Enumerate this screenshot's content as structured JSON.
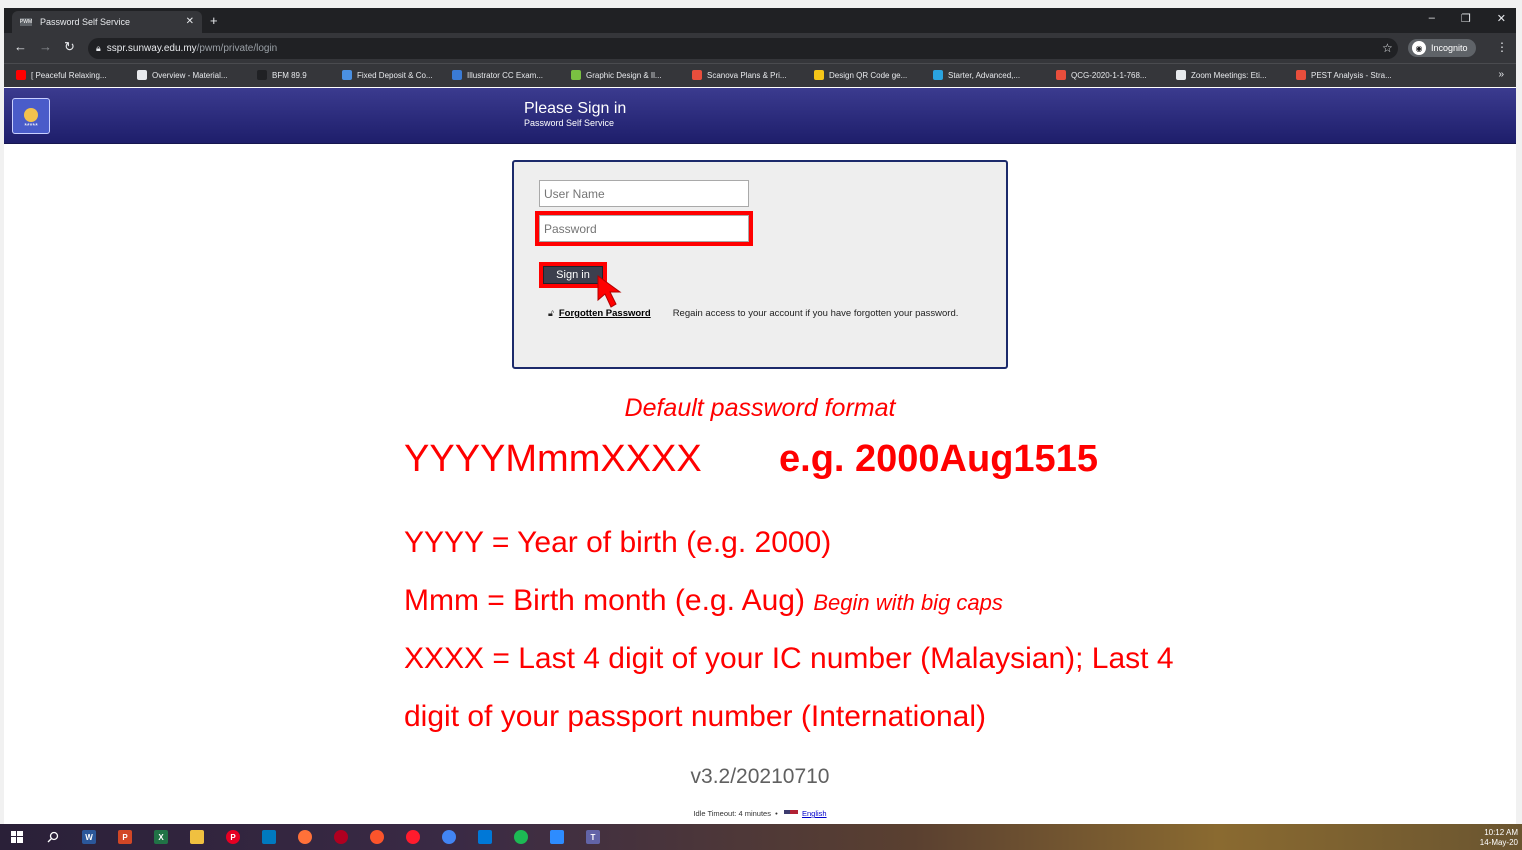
{
  "browser": {
    "tab_title": "Password Self Service",
    "tab_favicon": "PWM",
    "url_host": "sspr.sunway.edu.my",
    "url_path": "/pwm/private/login",
    "incognito_label": "Incognito",
    "bookmarks": [
      {
        "label": "[ Peaceful Relaxing...",
        "color": "#ff0000"
      },
      {
        "label": "Overview - Material...",
        "color": "#e8eaed"
      },
      {
        "label": "BFM 89.9",
        "color": "#202124"
      },
      {
        "label": "Fixed Deposit & Co...",
        "color": "#4a90e2"
      },
      {
        "label": "Illustrator CC Exam...",
        "color": "#3a7bd5"
      },
      {
        "label": "Graphic Design & Il...",
        "color": "#7ac142"
      },
      {
        "label": "Scanova Plans & Pri...",
        "color": "#e94e3c"
      },
      {
        "label": "Design QR Code ge...",
        "color": "#f5c518"
      },
      {
        "label": "Starter, Advanced,...",
        "color": "#2aa3e0"
      },
      {
        "label": "QCG-2020-1-1-768...",
        "color": "#e94e3c"
      },
      {
        "label": "Zoom Meetings: Eti...",
        "color": "#e8eaed"
      },
      {
        "label": "PEST Analysis - Stra...",
        "color": "#e94e3c"
      }
    ]
  },
  "header": {
    "title": "Please Sign in",
    "subtitle": "Password Self Service",
    "logo_stars": "*****"
  },
  "login": {
    "username_placeholder": "User Name",
    "password_placeholder": "Password",
    "signin_label": "Sign in",
    "forgot_link": "Forgotten Password",
    "forgot_desc": "Regain access to your account if you have forgotten your password."
  },
  "instructions": {
    "heading": "Default password format",
    "format": "YYYYMmmXXXX",
    "example": "e.g. 2000Aug1515",
    "yyyy": "YYYY = Year of birth (e.g. 2000)",
    "mmm": "Mmm = Birth month (e.g. Aug)",
    "mmm_note": "Begin with big caps",
    "xxxx_line1": "XXXX = Last 4 digit of your IC number (Malaysian); Last 4",
    "xxxx_line2": "digit of your passport number (International)"
  },
  "footer": {
    "version": "v3.2/20210710",
    "idle": "Idle Timeout: 4 minutes",
    "separator": "•",
    "language": "English"
  },
  "taskbar": {
    "time": "10:12 AM",
    "date": "14-May-20",
    "apps": [
      {
        "name": "windows-start-icon",
        "label": "",
        "color": "#ffffff"
      },
      {
        "name": "search-icon",
        "label": "",
        "color": "#ffffff"
      },
      {
        "name": "word-icon",
        "label": "W",
        "color": "#2b579a"
      },
      {
        "name": "powerpoint-icon",
        "label": "P",
        "color": "#d24726"
      },
      {
        "name": "excel-icon",
        "label": "X",
        "color": "#217346"
      },
      {
        "name": "file-explorer-icon",
        "label": "",
        "color": "#f0c040"
      },
      {
        "name": "pinterest-icon",
        "label": "P",
        "color": "#e60023"
      },
      {
        "name": "trello-icon",
        "label": "",
        "color": "#0079bf"
      },
      {
        "name": "firefox-icon",
        "label": "",
        "color": "#ff7139"
      },
      {
        "name": "opera-outline-icon",
        "label": "",
        "color": "#b00020"
      },
      {
        "name": "brave-icon",
        "label": "",
        "color": "#fb542b"
      },
      {
        "name": "opera-icon",
        "label": "",
        "color": "#ff1b2d"
      },
      {
        "name": "chrome-icon",
        "label": "",
        "color": "#4285f4"
      },
      {
        "name": "photos-icon",
        "label": "",
        "color": "#0078d7"
      },
      {
        "name": "spotify-icon",
        "label": "",
        "color": "#1db954"
      },
      {
        "name": "zoom-icon",
        "label": "",
        "color": "#2d8cff"
      },
      {
        "name": "teams-icon",
        "label": "T",
        "color": "#6264a7"
      }
    ]
  }
}
